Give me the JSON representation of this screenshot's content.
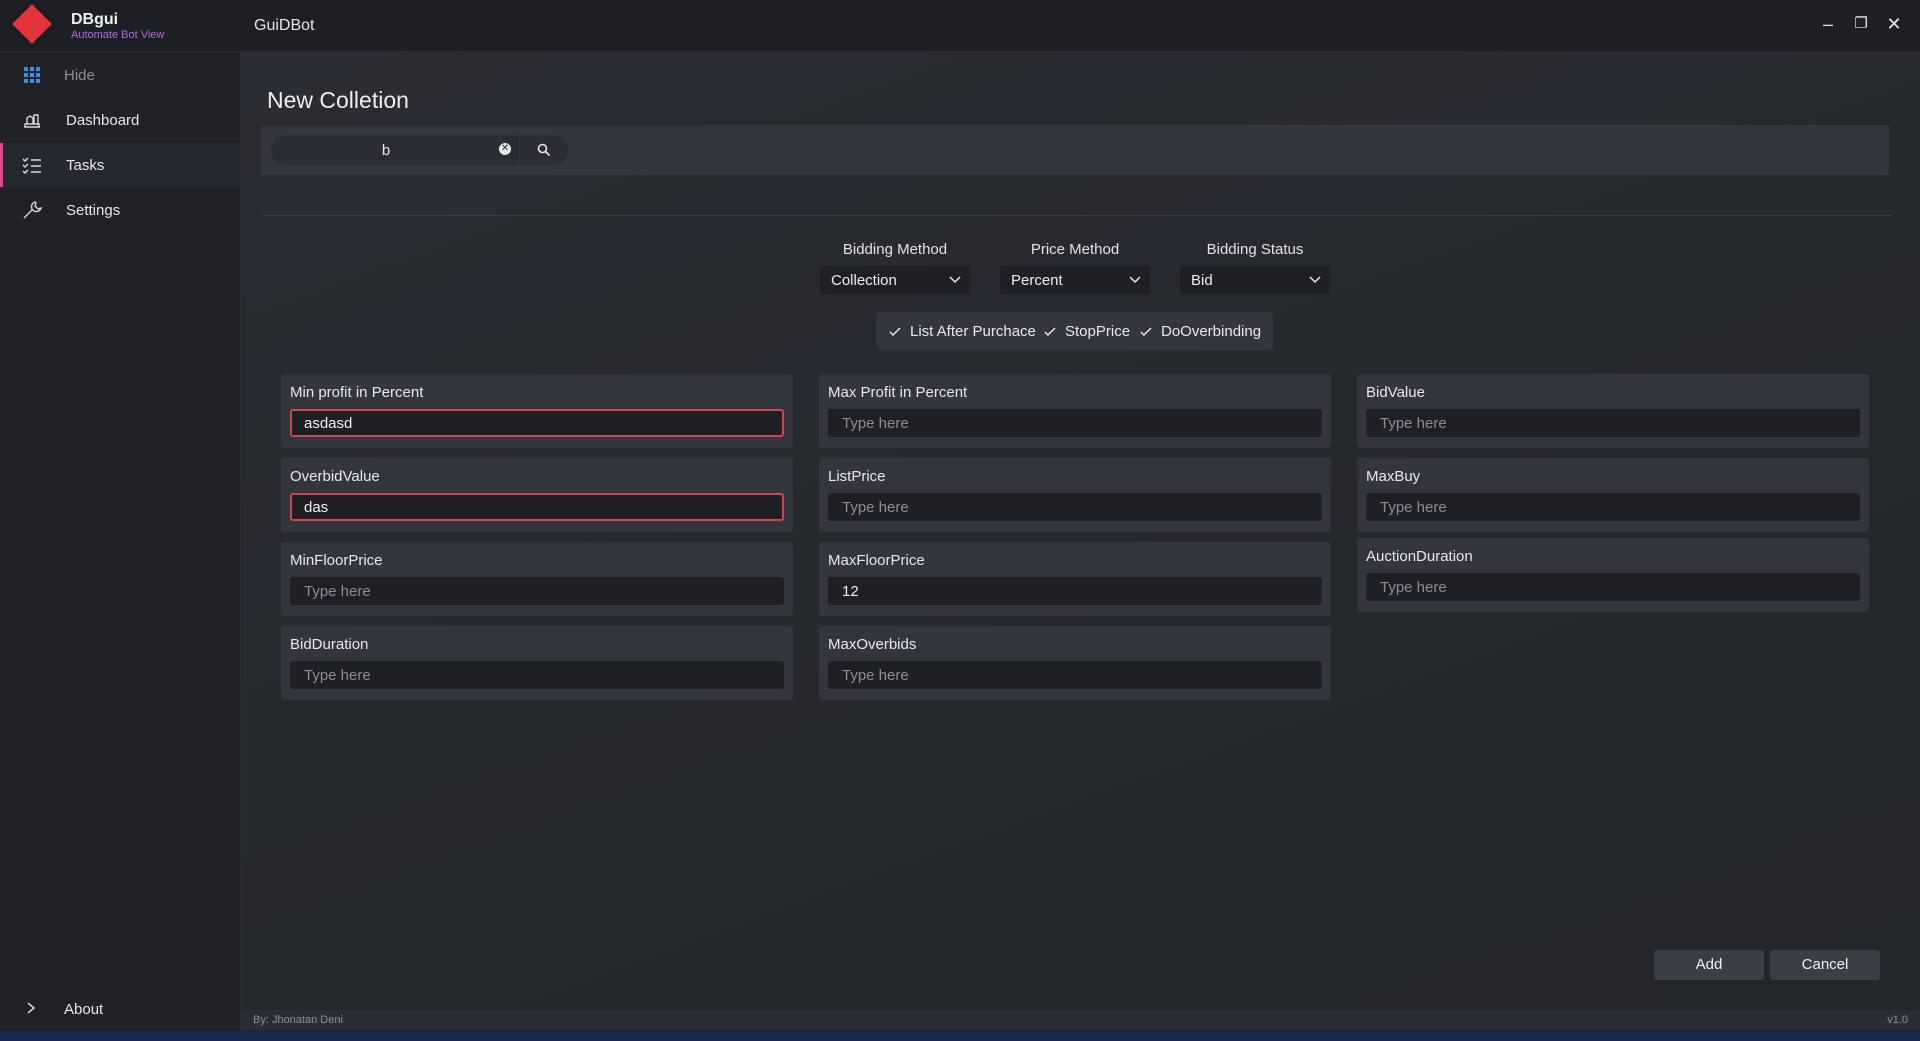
{
  "app": {
    "name": "DBgui",
    "subtitle": "Automate Bot View",
    "window_title": "GuiDBot"
  },
  "window_controls": {
    "minimize": "–",
    "restore": "❐",
    "close": "✕"
  },
  "sidebar": {
    "items": [
      {
        "label": "Hide",
        "icon": "grid-icon"
      },
      {
        "label": "Dashboard",
        "icon": "dashboard-icon"
      },
      {
        "label": "Tasks",
        "icon": "tasks-icon",
        "active": true
      },
      {
        "label": "Settings",
        "icon": "wrench-icon"
      }
    ],
    "about": {
      "label": "About",
      "icon": "chevron-right-icon"
    }
  },
  "page": {
    "title": "New Colletion"
  },
  "search": {
    "value": "b"
  },
  "dropdowns": [
    {
      "label": "Bidding Method",
      "value": "Collection"
    },
    {
      "label": "Price Method",
      "value": "Percent"
    },
    {
      "label": "Bidding Status",
      "value": "Bid"
    }
  ],
  "checkboxes": [
    {
      "label": "List After Purchace",
      "checked": true
    },
    {
      "label": "StopPrice",
      "checked": true
    },
    {
      "label": "DoOverbinding",
      "checked": true
    }
  ],
  "fields": {
    "col1": [
      {
        "label": "Min profit in Percent",
        "value": "asdasd",
        "error": true
      },
      {
        "label": "OverbidValue",
        "value": "das",
        "error": true
      },
      {
        "label": "MinFloorPrice",
        "placeholder": "Type here"
      },
      {
        "label": "BidDuration",
        "placeholder": "Type here"
      }
    ],
    "col2": [
      {
        "label": "Max Profit in Percent",
        "placeholder": "Type here"
      },
      {
        "label": "ListPrice",
        "placeholder": "Type here"
      },
      {
        "label": "MaxFloorPrice",
        "value": "12"
      },
      {
        "label": "MaxOverbids",
        "placeholder": "Type here"
      }
    ],
    "col3": [
      {
        "label": "BidValue",
        "placeholder": "Type here"
      },
      {
        "label": "MaxBuy",
        "placeholder": "Type here"
      },
      {
        "label": "AuctionDuration",
        "placeholder": "Type here"
      }
    ]
  },
  "actions": {
    "add": "Add",
    "cancel": "Cancel"
  },
  "footer": {
    "credit": "By: Jhonatan Deni",
    "version": "v1.0"
  },
  "colors": {
    "accent": "#e5458a",
    "logo": "#e5333c",
    "subtitle": "#b36be0",
    "error": "#d04555"
  }
}
